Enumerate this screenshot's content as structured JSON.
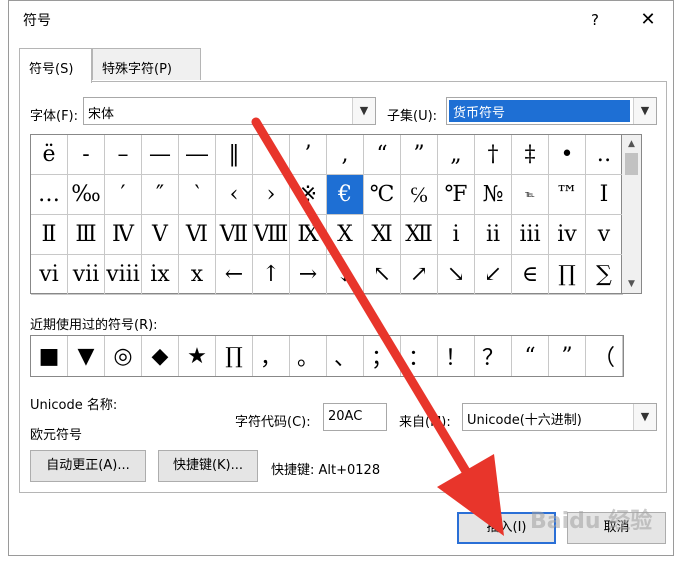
{
  "window": {
    "title": "符号",
    "help": "?",
    "close": "✕"
  },
  "tabs": [
    {
      "label": "符号(S)"
    },
    {
      "label": "特殊字符(P)"
    }
  ],
  "font": {
    "label": "字体(F):",
    "value": "宋体"
  },
  "subset": {
    "label": "子集(U):",
    "value": "货币符号"
  },
  "symbols": [
    [
      "ë",
      "-",
      "–",
      "—",
      "―",
      "‖",
      "‘",
      "’",
      ",",
      "“",
      "”",
      "„",
      "†",
      "‡",
      "•",
      "‥"
    ],
    [
      "…",
      "‰",
      "′",
      "″",
      "‵",
      "‹",
      "›",
      "※",
      "€",
      "℃",
      "℅",
      "℉",
      "№",
      "℡",
      "™",
      "Ⅰ"
    ],
    [
      "Ⅱ",
      "Ⅲ",
      "Ⅳ",
      "Ⅴ",
      "Ⅵ",
      "Ⅶ",
      "Ⅷ",
      "Ⅸ",
      "Ⅹ",
      "Ⅺ",
      "Ⅻ",
      "ⅰ",
      "ⅱ",
      "ⅲ",
      "ⅳ",
      "ⅴ"
    ],
    [
      "ⅵ",
      "ⅶ",
      "ⅷ",
      "ⅸ",
      "ⅹ",
      "←",
      "↑",
      "→",
      "↓",
      "↖",
      "↗",
      "↘",
      "↙",
      "∈",
      "∏",
      "∑"
    ]
  ],
  "selected_symbol": "€",
  "recent": {
    "label": "近期使用过的符号(R):",
    "symbols": [
      "■",
      "▼",
      "◎",
      "◆",
      "★",
      "∏",
      "，",
      "。",
      "、",
      "；",
      "：",
      "！",
      "？",
      "“",
      "”",
      "（"
    ]
  },
  "unicode_name": {
    "label": "Unicode 名称:",
    "value": "欧元符号"
  },
  "char_code": {
    "label": "字符代码(C):",
    "value": "20AC"
  },
  "from": {
    "label": "来自(M):",
    "value": "Unicode(十六进制)"
  },
  "buttons": {
    "autocorrect": "自动更正(A)...",
    "shortcut_key": "快捷键(K)...",
    "insert": "插入(I)",
    "cancel": "取消"
  },
  "shortcut": "快捷键: Alt+0128",
  "watermark": "Baidu 经验",
  "colors": {
    "selection": "#1e6fd4",
    "arrow": "#e8352b"
  }
}
